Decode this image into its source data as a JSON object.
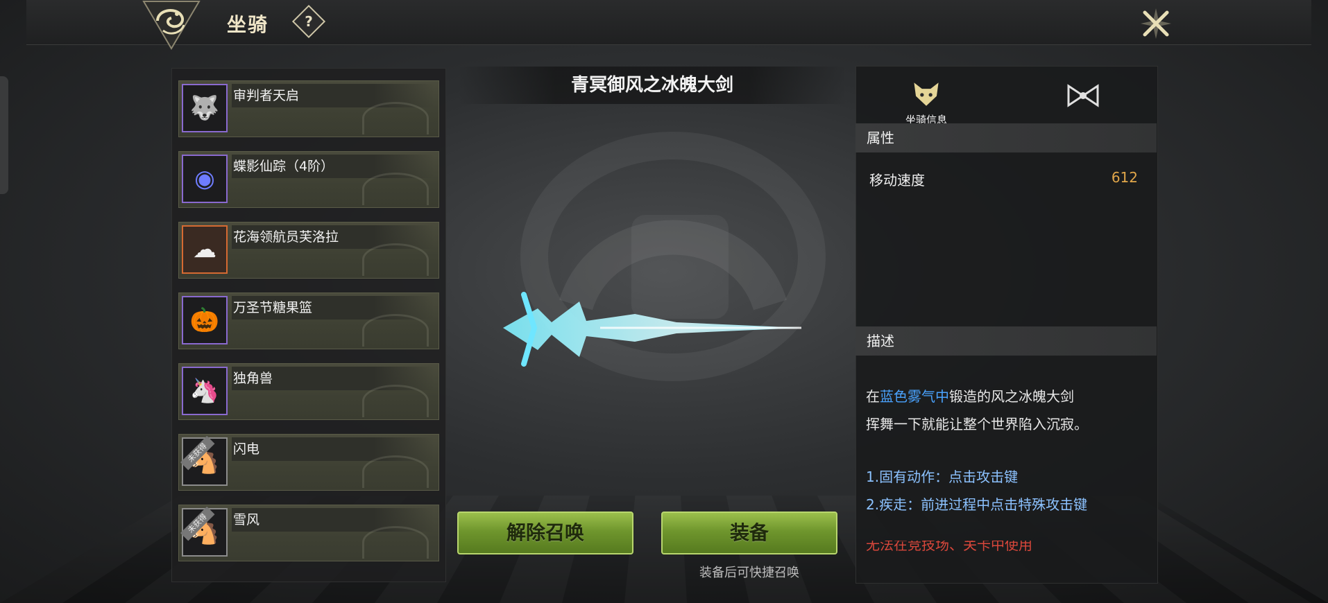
{
  "header": {
    "title": "坐骑",
    "help_label": "?",
    "emblem_icon": "dragon-crest-icon",
    "close_icon": "close-x-icon"
  },
  "mounts": [
    {
      "name": "审判者天启",
      "icon": "werewolf-icon",
      "rarity_color": "#8a6ad0",
      "locked": false
    },
    {
      "name": "蝶影仙踪（4阶）",
      "icon": "butterfly-orb-icon",
      "rarity_color": "#8a6ad0",
      "locked": false
    },
    {
      "name": "花海领航员芙洛拉",
      "icon": "cloud-sheep-icon",
      "rarity_color": "#d66a32",
      "locked": false
    },
    {
      "name": "万圣节糖果篮",
      "icon": "pumpkin-icon",
      "rarity_color": "#8a6ad0",
      "locked": false
    },
    {
      "name": "独角兽",
      "icon": "unicorn-icon",
      "rarity_color": "#8a6ad0",
      "locked": false
    },
    {
      "name": "闪电",
      "icon": "dark-horse-icon",
      "rarity_color": "#8c8c8c",
      "locked": true,
      "lock_label": "未获得"
    },
    {
      "name": "雪风",
      "icon": "white-horse-icon",
      "rarity_color": "#8c8c8c",
      "locked": true,
      "lock_label": "未获得"
    }
  ],
  "preview": {
    "mount_name": "青冥御风之冰魄大剑"
  },
  "actions": {
    "unsummon_label": "解除召唤",
    "equip_label": "装备",
    "equip_hint": "装备后可快捷召唤"
  },
  "info": {
    "tab_info_label": "坐骑信息",
    "tab_info_icon": "fox-head-icon",
    "tab_bow_icon": "bow-icon",
    "attributes_heading": "属性",
    "attributes": [
      {
        "name": "移动速度",
        "value": "612"
      }
    ],
    "description_heading": "描述",
    "description": {
      "line1_prefix": "在",
      "line1_highlight": "蓝色雾气中",
      "line1_suffix": "锻造的风之冰魄大剑",
      "line2": "挥舞一下就能让整个世界陷入沉寂。",
      "skill1": "1.固有动作：点击攻击键",
      "skill2": "2.疾走：前进过程中点击特殊攻击键",
      "warning": "无法在竞技场、关卡中使用"
    }
  },
  "colors": {
    "accent_green": "#7aa03a",
    "rarity_purple": "#8a6ad0",
    "rarity_orange": "#d66a32",
    "value_orange": "#e1a64a",
    "highlight_blue": "#4aa3ff"
  }
}
